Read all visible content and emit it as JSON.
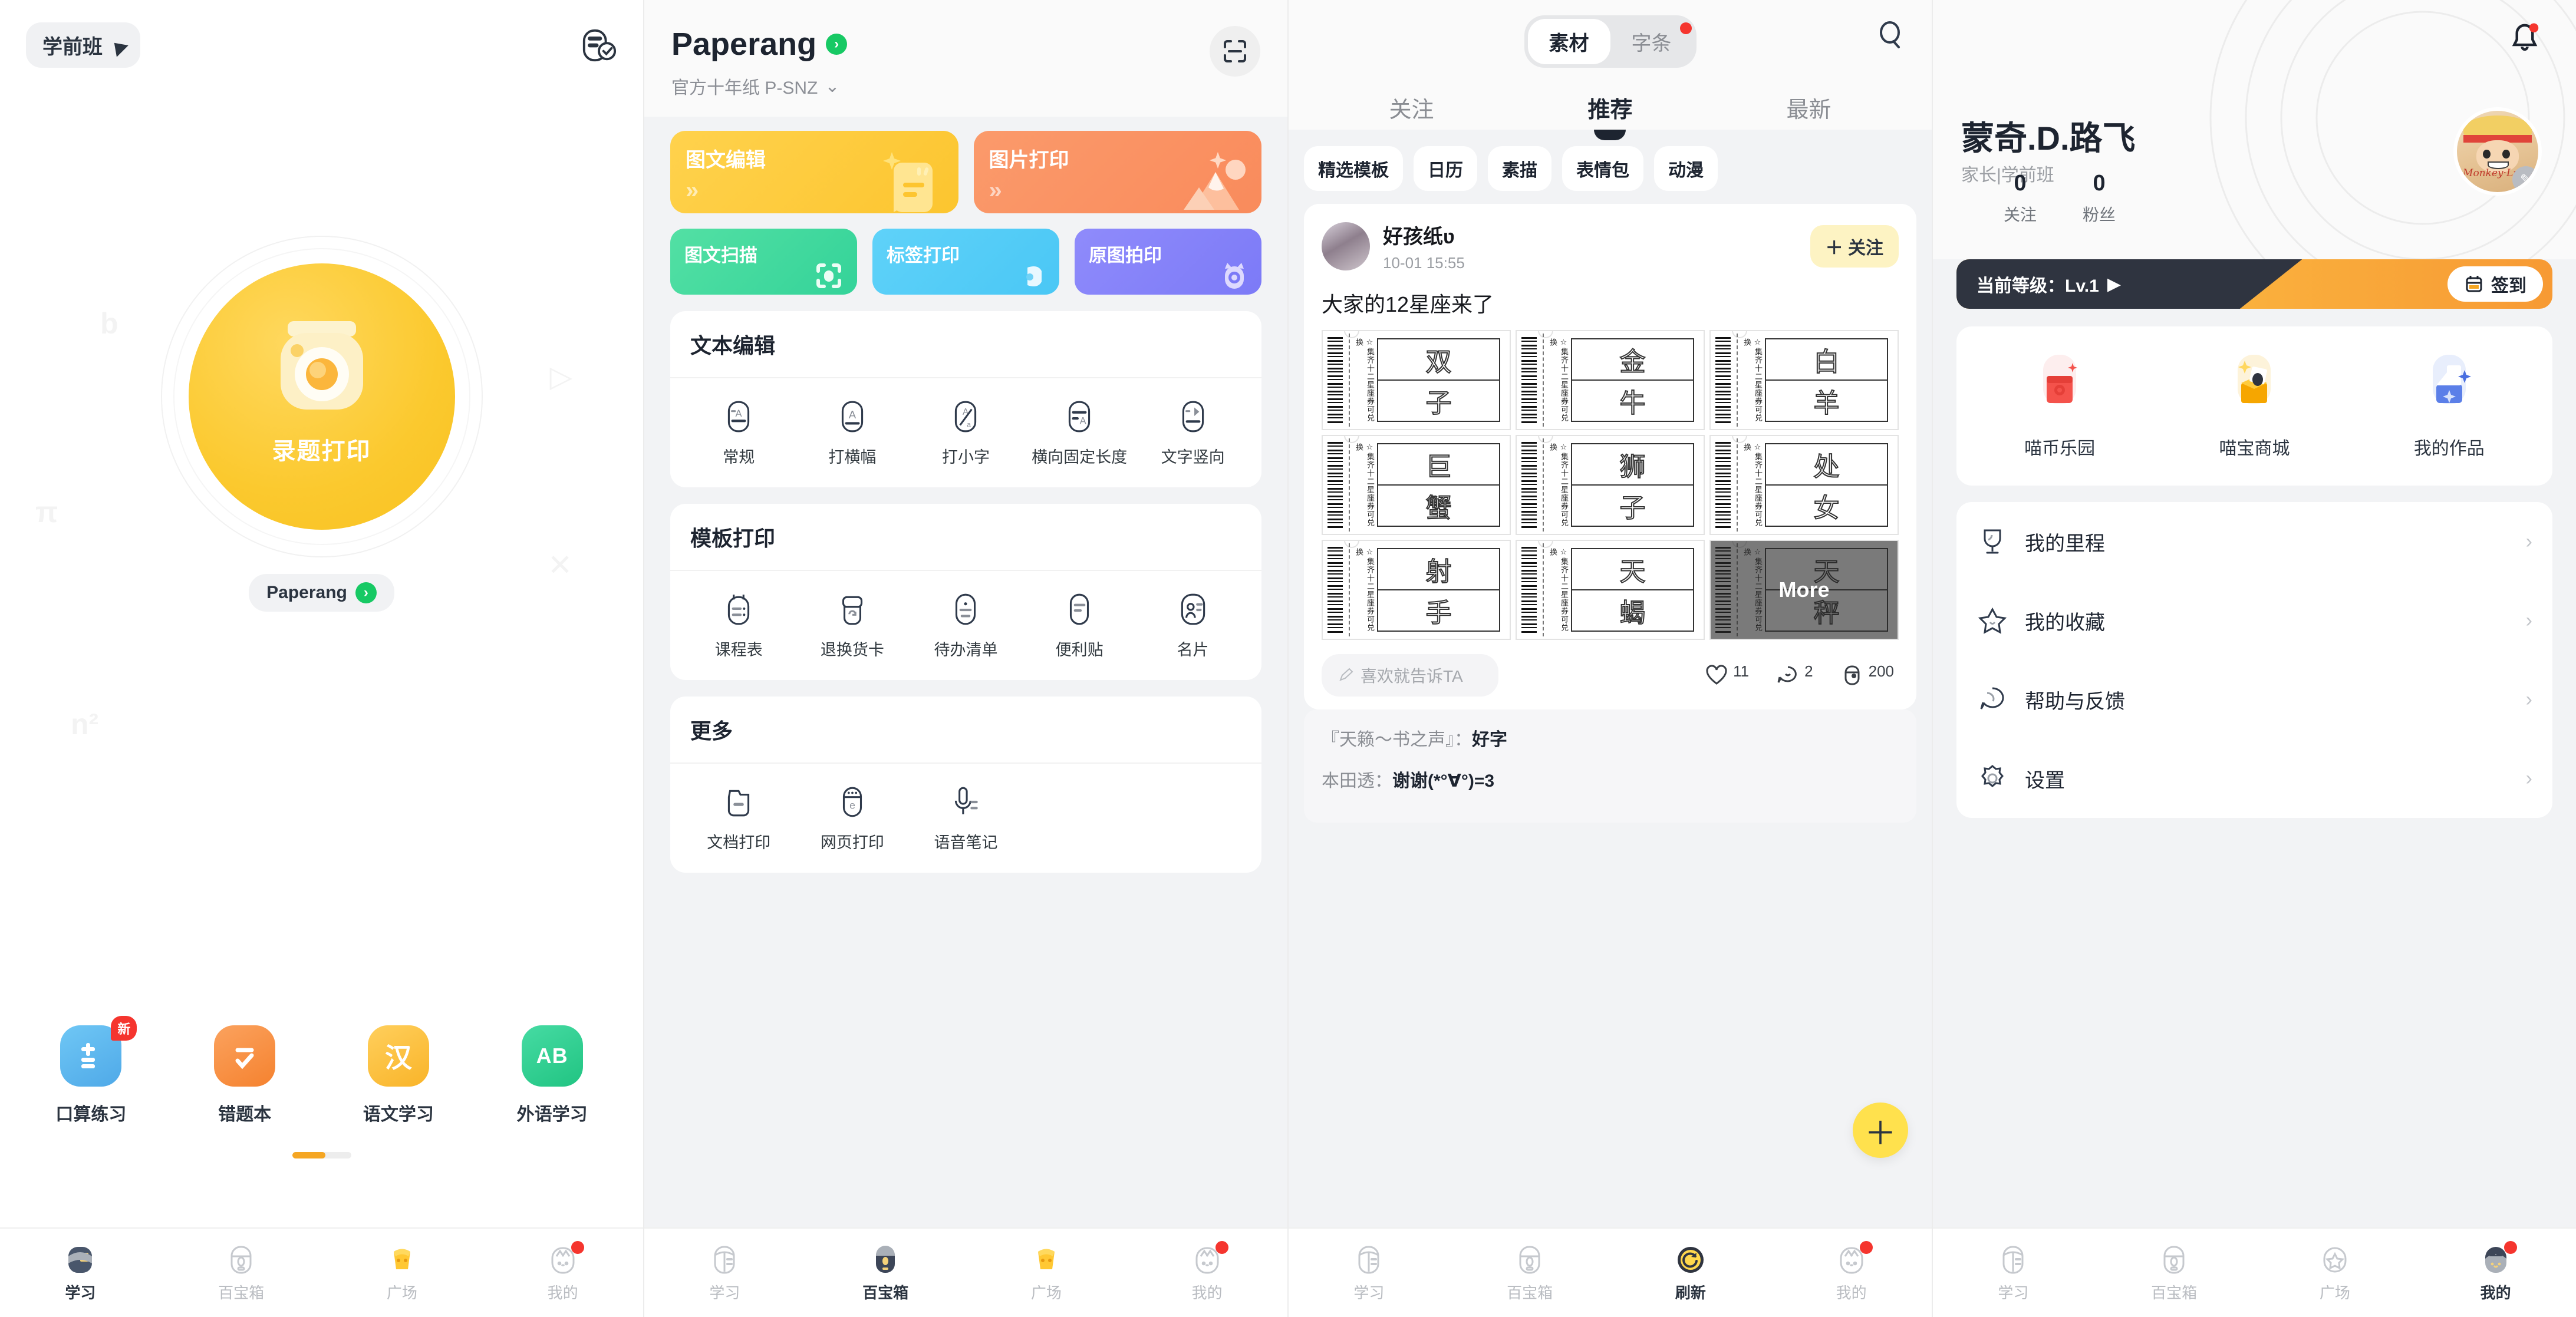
{
  "panel_study": {
    "grade_chip": "学前班",
    "hero": {
      "label": "录题打印",
      "chip_label": "Paperang"
    },
    "apps": [
      {
        "label": "口算练习",
        "badge": "新",
        "color": "#5ab8f0",
        "glyph": "+="
      },
      {
        "label": "错题本",
        "badge": "",
        "color": "#f58a38",
        "glyph": "-✓"
      },
      {
        "label": "语文学习",
        "badge": "",
        "color": "#fbc02d",
        "glyph": "汉"
      },
      {
        "label": "外语学习",
        "badge": "",
        "color": "#2ecc8f",
        "glyph": "AB"
      }
    ],
    "tabs": [
      {
        "label": "学习",
        "icon": "book-icon",
        "active": true,
        "dot": false
      },
      {
        "label": "百宝箱",
        "icon": "printer-icon",
        "active": false,
        "dot": false
      },
      {
        "label": "广场",
        "icon": "plaza-icon",
        "active": false,
        "dot": false
      },
      {
        "label": "我的",
        "icon": "cat-icon",
        "active": false,
        "dot": true
      }
    ]
  },
  "panel_printer": {
    "title": "Paperang",
    "subtitle": "官方十年纸 P-SNZ",
    "scan_icon": "scan-icon",
    "big_cards": [
      {
        "label": "图文编辑",
        "color": "#fbc52f"
      },
      {
        "label": "图片打印",
        "color": "#f98b5c"
      }
    ],
    "small_cards": [
      {
        "label": "图文扫描",
        "color": "#34d399"
      },
      {
        "label": "标签打印",
        "color": "#4ac7f5"
      },
      {
        "label": "原图拍印",
        "color": "#7c7af7"
      }
    ],
    "sections": [
      {
        "title": "文本编辑",
        "items": [
          {
            "label": "常规",
            "icon": "text-normal-icon"
          },
          {
            "label": "打横幅",
            "icon": "banner-icon"
          },
          {
            "label": "打小字",
            "icon": "small-text-icon"
          },
          {
            "label": "横向固定长度",
            "icon": "fixed-length-icon"
          },
          {
            "label": "文字竖向",
            "icon": "vertical-text-icon"
          }
        ]
      },
      {
        "title": "模板打印",
        "items": [
          {
            "label": "课程表",
            "icon": "timetable-icon"
          },
          {
            "label": "退换货卡",
            "icon": "return-card-icon"
          },
          {
            "label": "待办清单",
            "icon": "todo-icon"
          },
          {
            "label": "便利贴",
            "icon": "sticky-note-icon"
          },
          {
            "label": "名片",
            "icon": "business-card-icon"
          }
        ]
      },
      {
        "title": "更多",
        "items": [
          {
            "label": "文档打印",
            "icon": "folder-icon"
          },
          {
            "label": "网页打印",
            "icon": "webpage-icon"
          },
          {
            "label": "语音笔记",
            "icon": "microphone-icon"
          }
        ]
      }
    ],
    "tabs": [
      {
        "label": "学习",
        "icon": "book-icon",
        "active": false,
        "dot": false
      },
      {
        "label": "百宝箱",
        "icon": "printer-icon",
        "active": true,
        "dot": false
      },
      {
        "label": "广场",
        "icon": "plaza-icon",
        "active": false,
        "dot": false
      },
      {
        "label": "我的",
        "icon": "cat-icon",
        "active": false,
        "dot": true
      }
    ]
  },
  "panel_feed": {
    "segment": [
      {
        "label": "素材",
        "active": true,
        "dot": false
      },
      {
        "label": "字条",
        "active": false,
        "dot": true
      }
    ],
    "search_icon": "search-icon",
    "tabs": [
      {
        "label": "关注",
        "active": false
      },
      {
        "label": "推荐",
        "active": true
      },
      {
        "label": "最新",
        "active": false
      }
    ],
    "chips": [
      "精选模板",
      "日历",
      "素描",
      "表情包",
      "动漫"
    ],
    "post": {
      "author": "好孩纸ʋ",
      "time": "10-01 15:55",
      "follow_label": "＋ 关注",
      "title": "大家的12星座来了",
      "ticket_side_text": "☆集齐十二星座券可兑换",
      "tiles": [
        {
          "top": "双",
          "bottom": "子",
          "more": false
        },
        {
          "top": "金",
          "bottom": "牛",
          "more": false
        },
        {
          "top": "白",
          "bottom": "羊",
          "more": false
        },
        {
          "top": "巨",
          "bottom": "蟹",
          "more": false
        },
        {
          "top": "狮",
          "bottom": "子",
          "more": false
        },
        {
          "top": "处",
          "bottom": "女",
          "more": false
        },
        {
          "top": "射",
          "bottom": "手",
          "more": false
        },
        {
          "top": "天",
          "bottom": "蝎",
          "more": false
        },
        {
          "top": "天",
          "bottom": "秤",
          "more": true,
          "more_label": "More"
        }
      ],
      "say_placeholder": "喜欢就告诉TA",
      "likes": "11",
      "comments": "2",
      "prints": "200",
      "comment_list": [
        {
          "user": "『天籁～书之声』：",
          "text": "好字"
        },
        {
          "user": "本田透：",
          "text": "谢谢(*°∀°)=3"
        }
      ]
    },
    "fab_label": "＋",
    "tabs_bottom": [
      {
        "label": "学习",
        "icon": "book-icon",
        "active": false,
        "dot": false
      },
      {
        "label": "百宝箱",
        "icon": "printer-icon",
        "active": false,
        "dot": false
      },
      {
        "label": "刷新",
        "icon": "refresh-icon",
        "active": true,
        "dot": false
      },
      {
        "label": "我的",
        "icon": "cat-icon",
        "active": false,
        "dot": true
      }
    ]
  },
  "panel_profile": {
    "bell_icon": "bell-icon",
    "name": "蒙奇.D.路飞",
    "role": "家长|学前班",
    "avatar_signature": "Monkey·Luffy",
    "stats": [
      {
        "value": "0",
        "label": "关注"
      },
      {
        "value": "0",
        "label": "粉丝"
      }
    ],
    "level_text": "当前等级：Lv.1",
    "sign_label": "签到",
    "tools": [
      {
        "label": "喵币乐园",
        "icon": "coin-park-icon"
      },
      {
        "label": "喵宝商城",
        "icon": "shop-icon"
      },
      {
        "label": "我的作品",
        "icon": "my-works-icon"
      }
    ],
    "menu": [
      {
        "label": "我的里程",
        "icon": "trophy-icon"
      },
      {
        "label": "我的收藏",
        "icon": "star-icon"
      },
      {
        "label": "帮助与反馈",
        "icon": "help-icon"
      },
      {
        "label": "设置",
        "icon": "gear-icon"
      }
    ],
    "tabs": [
      {
        "label": "学习",
        "icon": "book-icon",
        "active": false,
        "dot": false
      },
      {
        "label": "百宝箱",
        "icon": "printer-icon",
        "active": false,
        "dot": false
      },
      {
        "label": "广场",
        "icon": "plaza-star-icon",
        "active": false,
        "dot": false
      },
      {
        "label": "我的",
        "icon": "cat-icon",
        "active": true,
        "dot": true
      }
    ]
  }
}
